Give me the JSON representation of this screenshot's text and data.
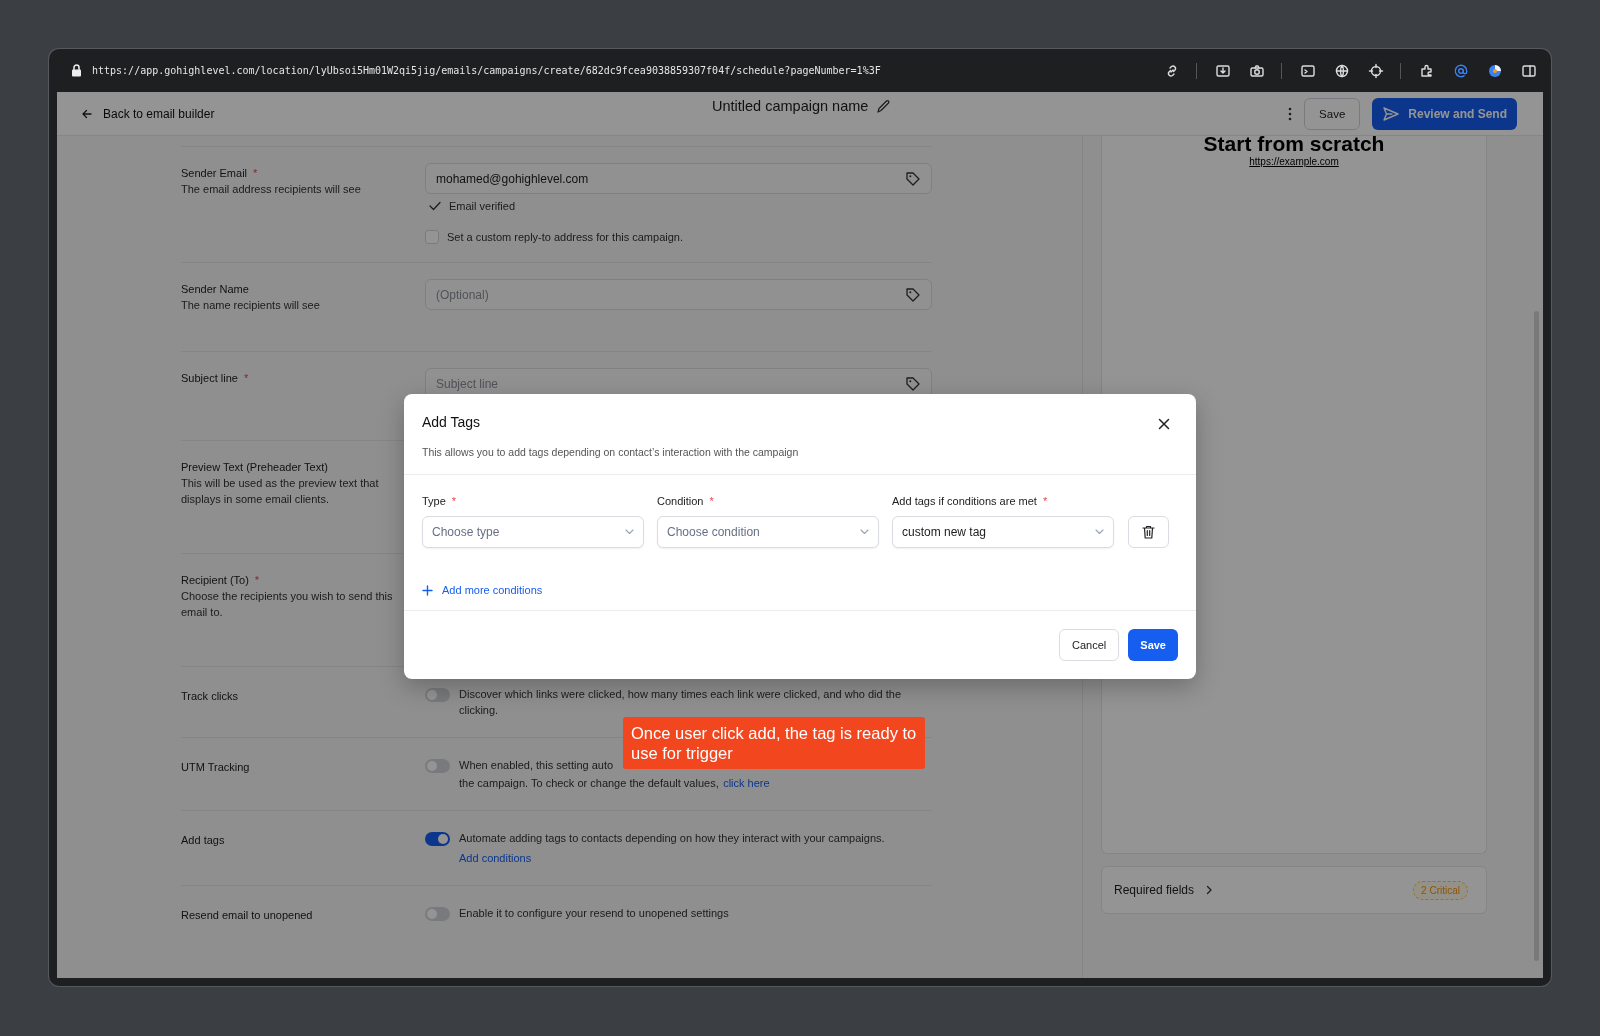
{
  "browser": {
    "url": "https://app.gohighlevel.com/location/lyUbsoi5Hm01W2qi5jig/emails/campaigns/create/682dc9fcea9038859307f04f/schedule?pageNumber=1%3F"
  },
  "header": {
    "back": "Back to email builder",
    "title": "Untitled campaign name",
    "save": "Save",
    "primary": "Review and Send"
  },
  "form": {
    "rows": [
      {
        "kind": "input",
        "label": "Sender Email",
        "required_mark": "*",
        "hint": "The email address recipients will see",
        "value": "mohamed@gohighlevel.com",
        "verified": "Email verified",
        "checkbox": {
          "label": "Set a custom reply-to address for this campaign.",
          "checked": false
        }
      },
      {
        "kind": "input",
        "label": "Sender Name",
        "hint": "The name recipients will see",
        "placeholder": "(Optional)"
      },
      {
        "kind": "input",
        "label": "Subject line",
        "required_mark": "*",
        "placeholder": "Subject line"
      },
      {
        "kind": "plain",
        "label": "Preview Text (Preheader Text)",
        "hint": "This will be used as the preview text that displays in some email clients."
      },
      {
        "kind": "plain",
        "label": "Recipient (To)",
        "required_mark": "*",
        "hint": "Choose the recipients you wish to send this email to."
      },
      {
        "kind": "toggle",
        "label": "Track clicks",
        "on": false,
        "lines": [
          "Discover which links were clicked, how many times each link were clicked, and who did the clicking."
        ]
      },
      {
        "kind": "toggle",
        "label": "UTM Tracking",
        "on": false,
        "lines": [
          "When enabled, this setting auto",
          "the campaign. To check or change the default values,"
        ],
        "link": "click here"
      },
      {
        "kind": "toggle",
        "label": "Add tags",
        "on": true,
        "lines": [
          "Automate adding tags to contacts depending on how they interact with your campaigns."
        ],
        "action": "Add conditions"
      },
      {
        "kind": "toggle",
        "label": "Resend email to unopened",
        "on": false,
        "lines": [
          "Enable it to configure your resend to unopened settings"
        ]
      }
    ]
  },
  "preview": {
    "title": "Start from scratch",
    "link": "https://example.com"
  },
  "required_fields": {
    "label": "Required fields",
    "badge": "2 Critical"
  },
  "modal": {
    "title": "Add Tags",
    "description": "This allows you to add tags depending on contact’s interaction with the campaign",
    "fields": [
      {
        "label": "Type",
        "required_mark": "*",
        "placeholder": "Choose type"
      },
      {
        "label": "Condition",
        "required_mark": "*",
        "placeholder": "Choose condition"
      },
      {
        "label": "Add tags if conditions are met",
        "required_mark": "*",
        "value": "custom new tag"
      }
    ],
    "add_more": "Add more conditions",
    "cancel": "Cancel",
    "save": "Save"
  },
  "callout": {
    "text": "Once user click add, the tag is ready to use for trigger"
  }
}
